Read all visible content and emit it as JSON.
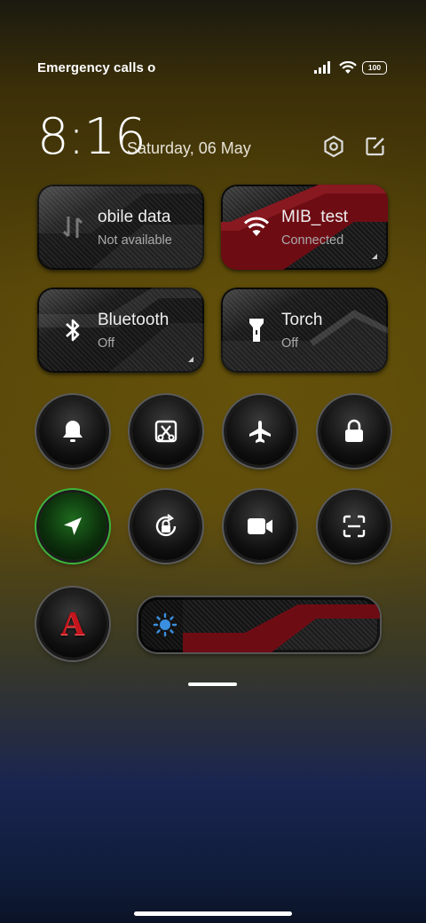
{
  "status": {
    "carrier": "Emergency calls o",
    "battery": "100"
  },
  "header": {
    "time": "8:16",
    "date": "Saturday, 06 May"
  },
  "tiles": [
    {
      "title": "obile data",
      "subtitle": "Not available",
      "icon": "mobile-data-icon"
    },
    {
      "title": "MIB_test",
      "subtitle": "Connected",
      "icon": "wifi-icon"
    },
    {
      "title": "Bluetooth",
      "subtitle": "Off",
      "icon": "bluetooth-icon"
    },
    {
      "title": "Torch",
      "subtitle": "Off",
      "icon": "torch-icon"
    }
  ],
  "toggles": [
    {
      "icon": "bell-icon"
    },
    {
      "icon": "screenshot-icon"
    },
    {
      "icon": "airplane-icon"
    },
    {
      "icon": "lock-icon"
    },
    {
      "icon": "location-icon",
      "active": true
    },
    {
      "icon": "rotation-lock-icon"
    },
    {
      "icon": "video-camera-icon"
    },
    {
      "icon": "scanner-icon"
    },
    {
      "icon": "reading-mode-icon",
      "label": "A"
    }
  ],
  "brightness": {
    "icon": "brightness-icon"
  },
  "colors": {
    "accent_red": "#7a0f16",
    "active_green": "#3cb43c",
    "brightness_blue": "#3a8fe0"
  }
}
